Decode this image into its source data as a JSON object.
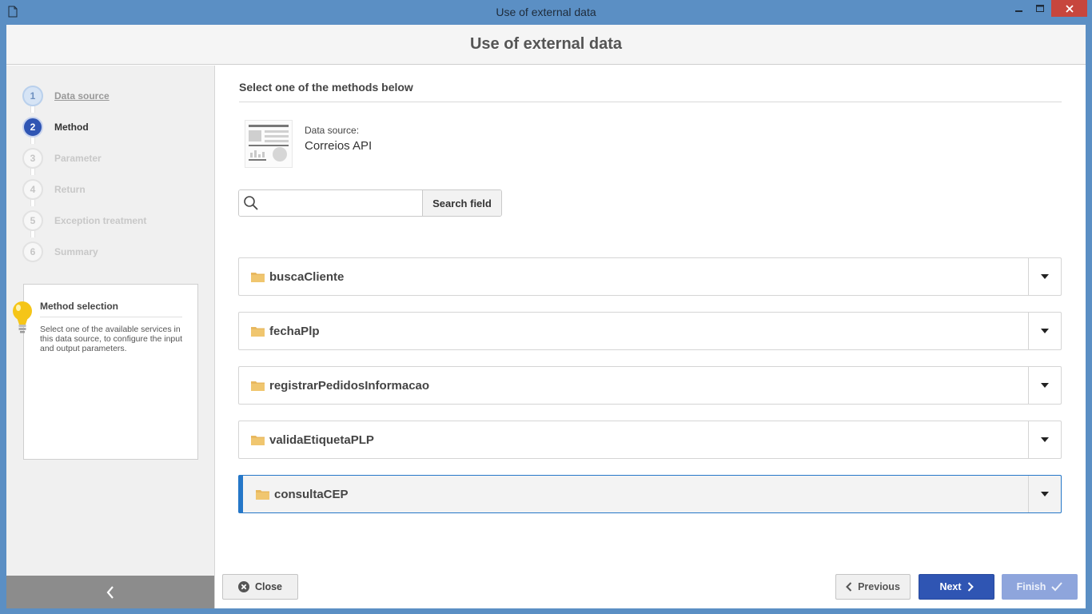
{
  "window": {
    "title": "Use of external data"
  },
  "header": {
    "title": "Use of external data"
  },
  "steps": [
    {
      "number": "1",
      "label": "Data source",
      "state": "done"
    },
    {
      "number": "2",
      "label": "Method",
      "state": "active"
    },
    {
      "number": "3",
      "label": "Parameter",
      "state": "pending"
    },
    {
      "number": "4",
      "label": "Return",
      "state": "pending"
    },
    {
      "number": "5",
      "label": "Exception treatment",
      "state": "pending"
    },
    {
      "number": "6",
      "label": "Summary",
      "state": "pending"
    }
  ],
  "help": {
    "title": "Method selection",
    "text": "Select one of the available services in this data source, to configure the input and output parameters."
  },
  "main": {
    "section_title": "Select one of the methods below",
    "data_source_caption": "Data source:",
    "data_source_name": "Correios API",
    "search": {
      "value": "",
      "button_label": "Search field"
    },
    "methods": [
      {
        "name": "buscaCliente",
        "selected": false
      },
      {
        "name": "fechaPlp",
        "selected": false
      },
      {
        "name": "registrarPedidosInformacao",
        "selected": false
      },
      {
        "name": "validaEtiquetaPLP",
        "selected": false
      },
      {
        "name": "consultaCEP",
        "selected": true
      }
    ]
  },
  "footer": {
    "close_label": "Close",
    "previous_label": "Previous",
    "next_label": "Next",
    "finish_label": "Finish"
  },
  "colors": {
    "accent": "#2f55b3",
    "selected_border": "#2577c8",
    "folder": "#e8b85f",
    "close_button": "#c7463d"
  }
}
